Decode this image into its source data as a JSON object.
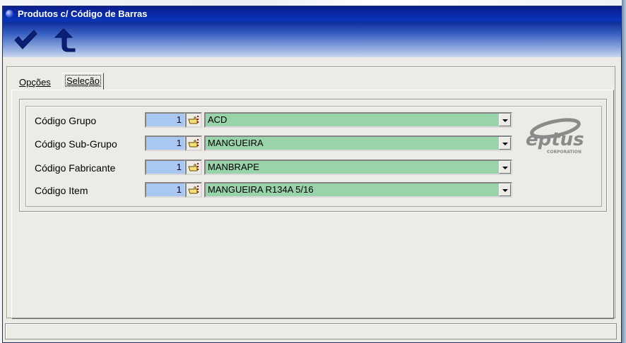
{
  "window": {
    "title": "Produtos c/ Código de Barras"
  },
  "toolbar": {
    "confirm_icon": "checkmark-icon",
    "back_icon": "return-arrow-icon"
  },
  "tabs": [
    {
      "label": "Opções",
      "active": false
    },
    {
      "label": "Seleção",
      "active": true
    }
  ],
  "fields": [
    {
      "label": "Código Grupo",
      "code": "1",
      "description": "ACD"
    },
    {
      "label": "Código Sub-Grupo",
      "code": "1",
      "description": "MANGUEIRA"
    },
    {
      "label": "Código Fabricante",
      "code": "1",
      "description": "MANBRAPE"
    },
    {
      "label": "Código Item",
      "code": "1",
      "description": "MANGUEIRA R134A 5/16"
    }
  ],
  "logo": {
    "name": "eptus",
    "tagline": "CORPORATION"
  },
  "colors": {
    "code_field": "#a8c8f2",
    "description_field": "#98d3aa",
    "titlebar": "#0a2aa8"
  }
}
